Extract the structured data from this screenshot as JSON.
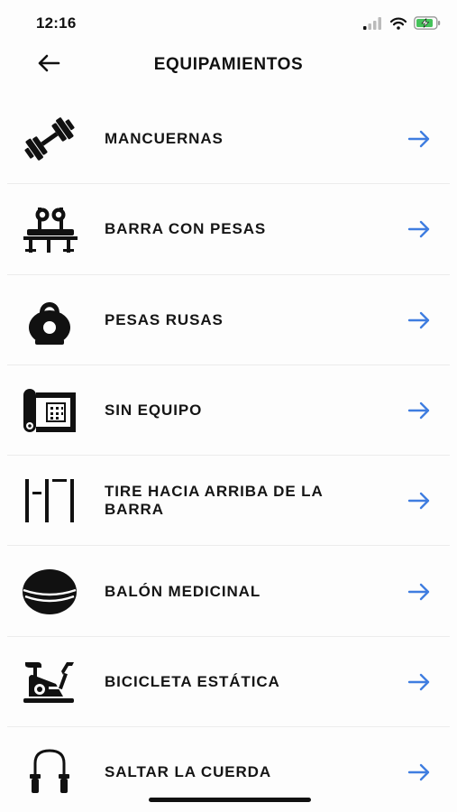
{
  "status_bar": {
    "time": "12:16"
  },
  "header": {
    "title": "EQUIPAMIENTOS",
    "back_icon": "arrow-left-icon"
  },
  "colors": {
    "accent": "#3f7de0",
    "text": "#151515",
    "divider": "#ececec",
    "battery_fill": "#45c25a"
  },
  "equipment": [
    {
      "label": "MANCUERNAS",
      "icon": "dumbbell-icon"
    },
    {
      "label": "BARRA CON PESAS",
      "icon": "barbell-bench-icon"
    },
    {
      "label": "PESAS RUSAS",
      "icon": "kettlebell-icon"
    },
    {
      "label": "SIN EQUIPO",
      "icon": "yoga-mat-icon"
    },
    {
      "label": "TIRE HACIA ARRIBA DE LA BARRA",
      "icon": "pull-up-bar-icon"
    },
    {
      "label": "BALÓN MEDICINAL",
      "icon": "medicine-ball-icon"
    },
    {
      "label": "BICICLETA ESTÁTICA",
      "icon": "stationary-bike-icon"
    },
    {
      "label": "SALTAR LA CUERDA",
      "icon": "jump-rope-icon"
    }
  ]
}
